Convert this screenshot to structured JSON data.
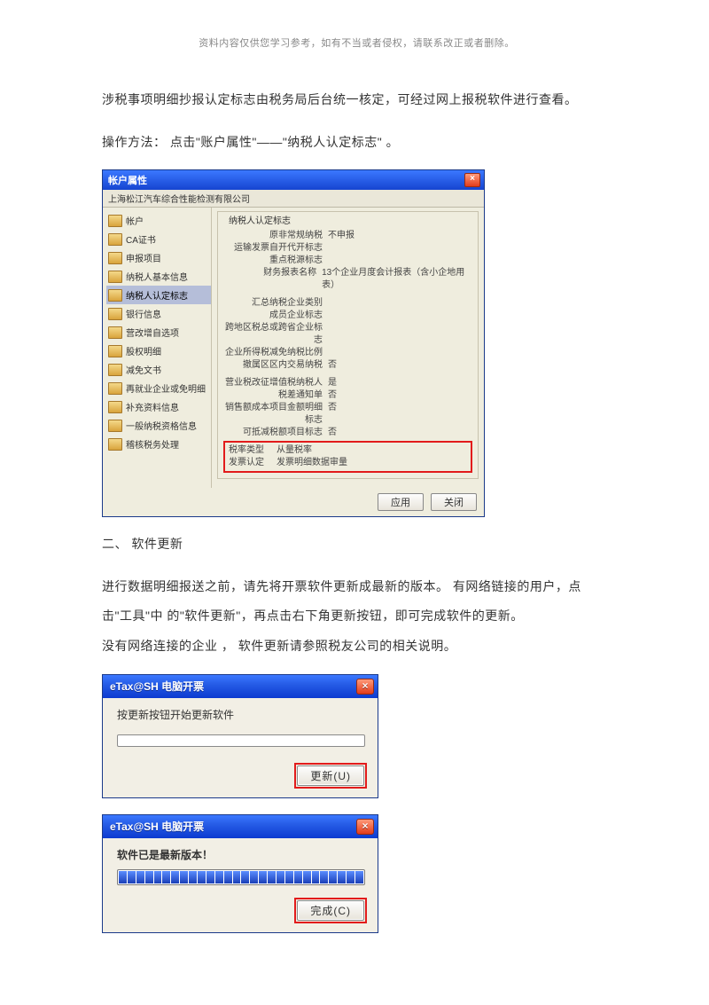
{
  "disclaimer": "资料内容仅供您学习参考，如有不当或者侵权，请联系改正或者删除。",
  "para1": "涉税事项明细抄报认定标志由税务局后台统一核定，可经过网上报税软件进行查看。",
  "para2": "操作方法： 点击\"账户属性\"——\"纳税人认定标志\"  。",
  "heading2": "二、 软件更新",
  "para3": "进行数据明细报送之前，请先将开票软件更新成最新的版本。 有网络链接的用户，点",
  "para4": "击\"工具\"中 的\"软件更新\"，再点击右下角更新按钮，即可完成软件的更新。",
  "para5": "没有网络连接的企业 ， 软件更新请参照税友公司的相关说明。",
  "acct": {
    "title": "帐户属性",
    "company": "上海松江汽车综合性能检测有限公司",
    "group_title": "纳税人认定标志",
    "nav": [
      "帐户",
      "CA证书",
      "申报项目",
      "纳税人基本信息",
      "纳税人认定标志",
      "银行信息",
      "营改增自选项",
      "股权明细",
      "减免文书",
      "再就业企业或免明细",
      "补充资料信息",
      "一般纳税资格信息",
      "稽核税务处理"
    ],
    "rows1": [
      {
        "lbl": "原非常规纳税",
        "val": "不申报"
      },
      {
        "lbl": "运输发票自开代开标志",
        "val": ""
      },
      {
        "lbl": "重点税源标志",
        "val": ""
      },
      {
        "lbl": "财务报表名称",
        "val": "13个企业月度会计报表（含小企地用表）"
      }
    ],
    "rows2": [
      {
        "lbl": "汇总纳税企业类别",
        "val": ""
      },
      {
        "lbl": "成员企业标志",
        "val": ""
      },
      {
        "lbl": "跨地区税总或跨省企业标志",
        "val": ""
      },
      {
        "lbl": "企业所得税减免纳税比例",
        "val": ""
      },
      {
        "lbl": "撤属区区内交易纳税",
        "val": "否"
      }
    ],
    "rows3": [
      {
        "lbl": "营业税改征增值税纳税人",
        "val": "是"
      },
      {
        "lbl": "税差通知单",
        "val": "否"
      },
      {
        "lbl": "销售额成本项目金额明细标志",
        "val": "否"
      },
      {
        "lbl": "可抵减税额项目标志",
        "val": "否"
      }
    ],
    "hl": [
      {
        "lbl": "税率类型",
        "val": "从量税率"
      },
      {
        "lbl": "发票认定",
        "val": "发票明细数据审量"
      }
    ],
    "btn_apply": "应用",
    "btn_close": "关闭"
  },
  "dlg1": {
    "title": "eTax@SH 电脑开票",
    "msg": "按更新按钮开始更新软件",
    "btn": "更新(U)"
  },
  "dlg2": {
    "title": "eTax@SH 电脑开票",
    "msg": "软件已是最新版本！",
    "btn": "完成(C)"
  }
}
